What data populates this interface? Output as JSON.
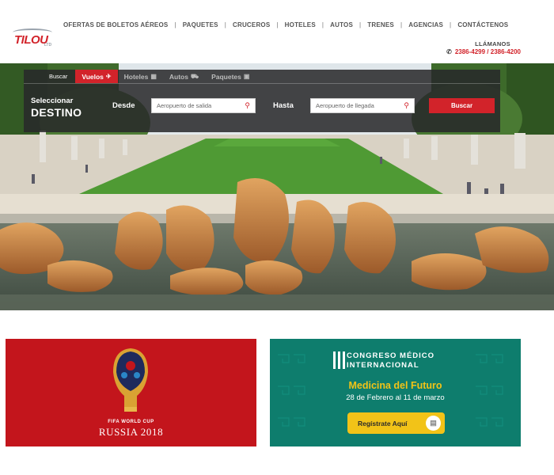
{
  "brand": {
    "logo_text": "TILOU",
    "logo_sub": "LTD",
    "accent": "#d2232a"
  },
  "nav": {
    "items": [
      "OFERTAS DE BOLETOS AÉREOS",
      "PAQUETES",
      "CRUCEROS",
      "HOTELES",
      "AUTOS",
      "TRENES",
      "AGENCIAS",
      "CONTÁCTENOS"
    ],
    "separator": "|"
  },
  "contact": {
    "label": "LLÁMANOS",
    "phones": "2386-4299 / 2386-4200",
    "icon": "phone-icon"
  },
  "search": {
    "tabs_label": "Buscar",
    "tabs": [
      {
        "label": "Vuelos",
        "icon": "plane-icon",
        "glyph": "✈",
        "active": true
      },
      {
        "label": "Hoteles",
        "icon": "building-icon",
        "glyph": "▦",
        "active": false
      },
      {
        "label": "Autos",
        "icon": "car-icon",
        "glyph": "⛟",
        "active": false
      },
      {
        "label": "Paquetes",
        "icon": "suitcase-icon",
        "glyph": "▣",
        "active": false
      }
    ],
    "heading_line1": "Seleccionar",
    "heading_line2": "DESTINO",
    "from_label": "Desde",
    "from_placeholder": "Aeropuerto de salida",
    "to_label": "Hasta",
    "to_placeholder": "Aeropuerto de llegada",
    "button": "Buscar"
  },
  "banners": {
    "worldcup": {
      "line1": "FIFA WORLD CUP",
      "line2": "RUSSIA 2018",
      "bg": "#c3151c"
    },
    "congress": {
      "line1": "CONGRESO MÉDICO",
      "line2": "INTERNACIONAL",
      "subtitle": "Medicina del Futuro",
      "dates": "28 de Febrero al  11 de marzo",
      "button": "Regístrate Aquí",
      "bg": "#0e7d6d",
      "accent": "#f2c318"
    }
  }
}
